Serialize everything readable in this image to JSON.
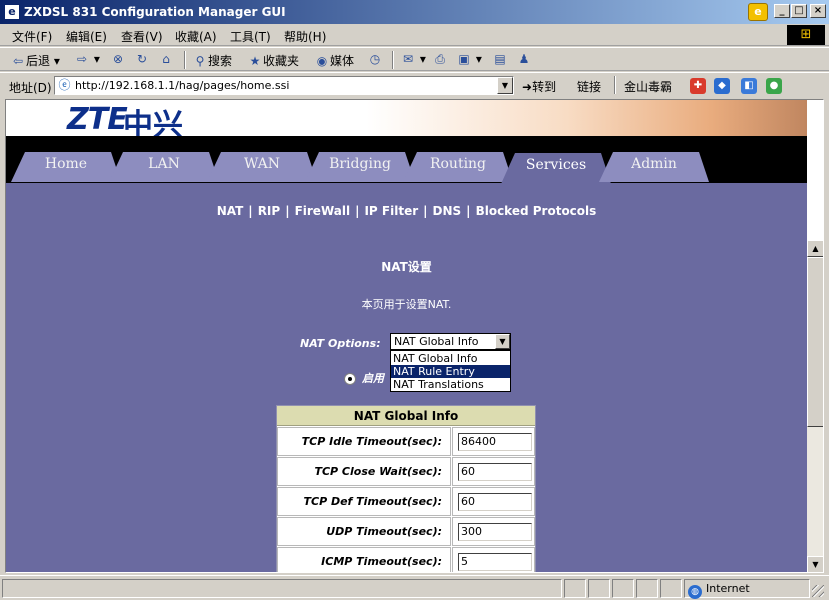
{
  "window": {
    "title": "ZXDSL 831 Configuration Manager GUI",
    "minimize": "_",
    "maximize": "□",
    "close": "×"
  },
  "menu": [
    "文件(F)",
    "编辑(E)",
    "查看(V)",
    "收藏(A)",
    "工具(T)",
    "帮助(H)"
  ],
  "toolbar": {
    "back": "后退",
    "search": "搜索",
    "favorites": "收藏夹",
    "media": "媒体"
  },
  "address": {
    "label": "地址(D)",
    "url": "http://192.168.1.1/hag/pages/home.ssi",
    "go": "转到",
    "links": "链接",
    "jinshan": "金山毒霸"
  },
  "banner": {
    "logo_latin": "ZTE",
    "logo_cn": "中兴"
  },
  "nav": {
    "tabs": [
      "Home",
      "LAN",
      "WAN",
      "Bridging",
      "Routing",
      "Services",
      "Admin"
    ],
    "active": "Services"
  },
  "subnav": [
    "NAT",
    "RIP",
    "FireWall",
    "IP Filter",
    "DNS",
    "Blocked Protocols"
  ],
  "subnav_sep": "|",
  "page": {
    "title": "NAT设置",
    "description": "本页用于设置NAT.",
    "options_label": "NAT Options:",
    "selected": "NAT Global Info",
    "dropdown": [
      "NAT Global Info",
      "NAT Rule Entry",
      "NAT Translations"
    ],
    "highlighted_index": 1,
    "radio_label": "启用"
  },
  "panel": {
    "header": "NAT Global Info",
    "rows": [
      {
        "label": "TCP Idle Timeout(sec):",
        "value": "86400"
      },
      {
        "label": "TCP Close Wait(sec):",
        "value": "60"
      },
      {
        "label": "TCP Def Timeout(sec):",
        "value": "60"
      },
      {
        "label": "UDP Timeout(sec):",
        "value": "300"
      },
      {
        "label": "ICMP Timeout(sec):",
        "value": "5"
      }
    ]
  },
  "status": {
    "zone": "Internet"
  },
  "colors": {
    "content_bg": "#6a6aa0",
    "tab_bg": "#8d8dbf",
    "panel_header": "#dcdcb0",
    "titlebar": "#0a246a"
  }
}
